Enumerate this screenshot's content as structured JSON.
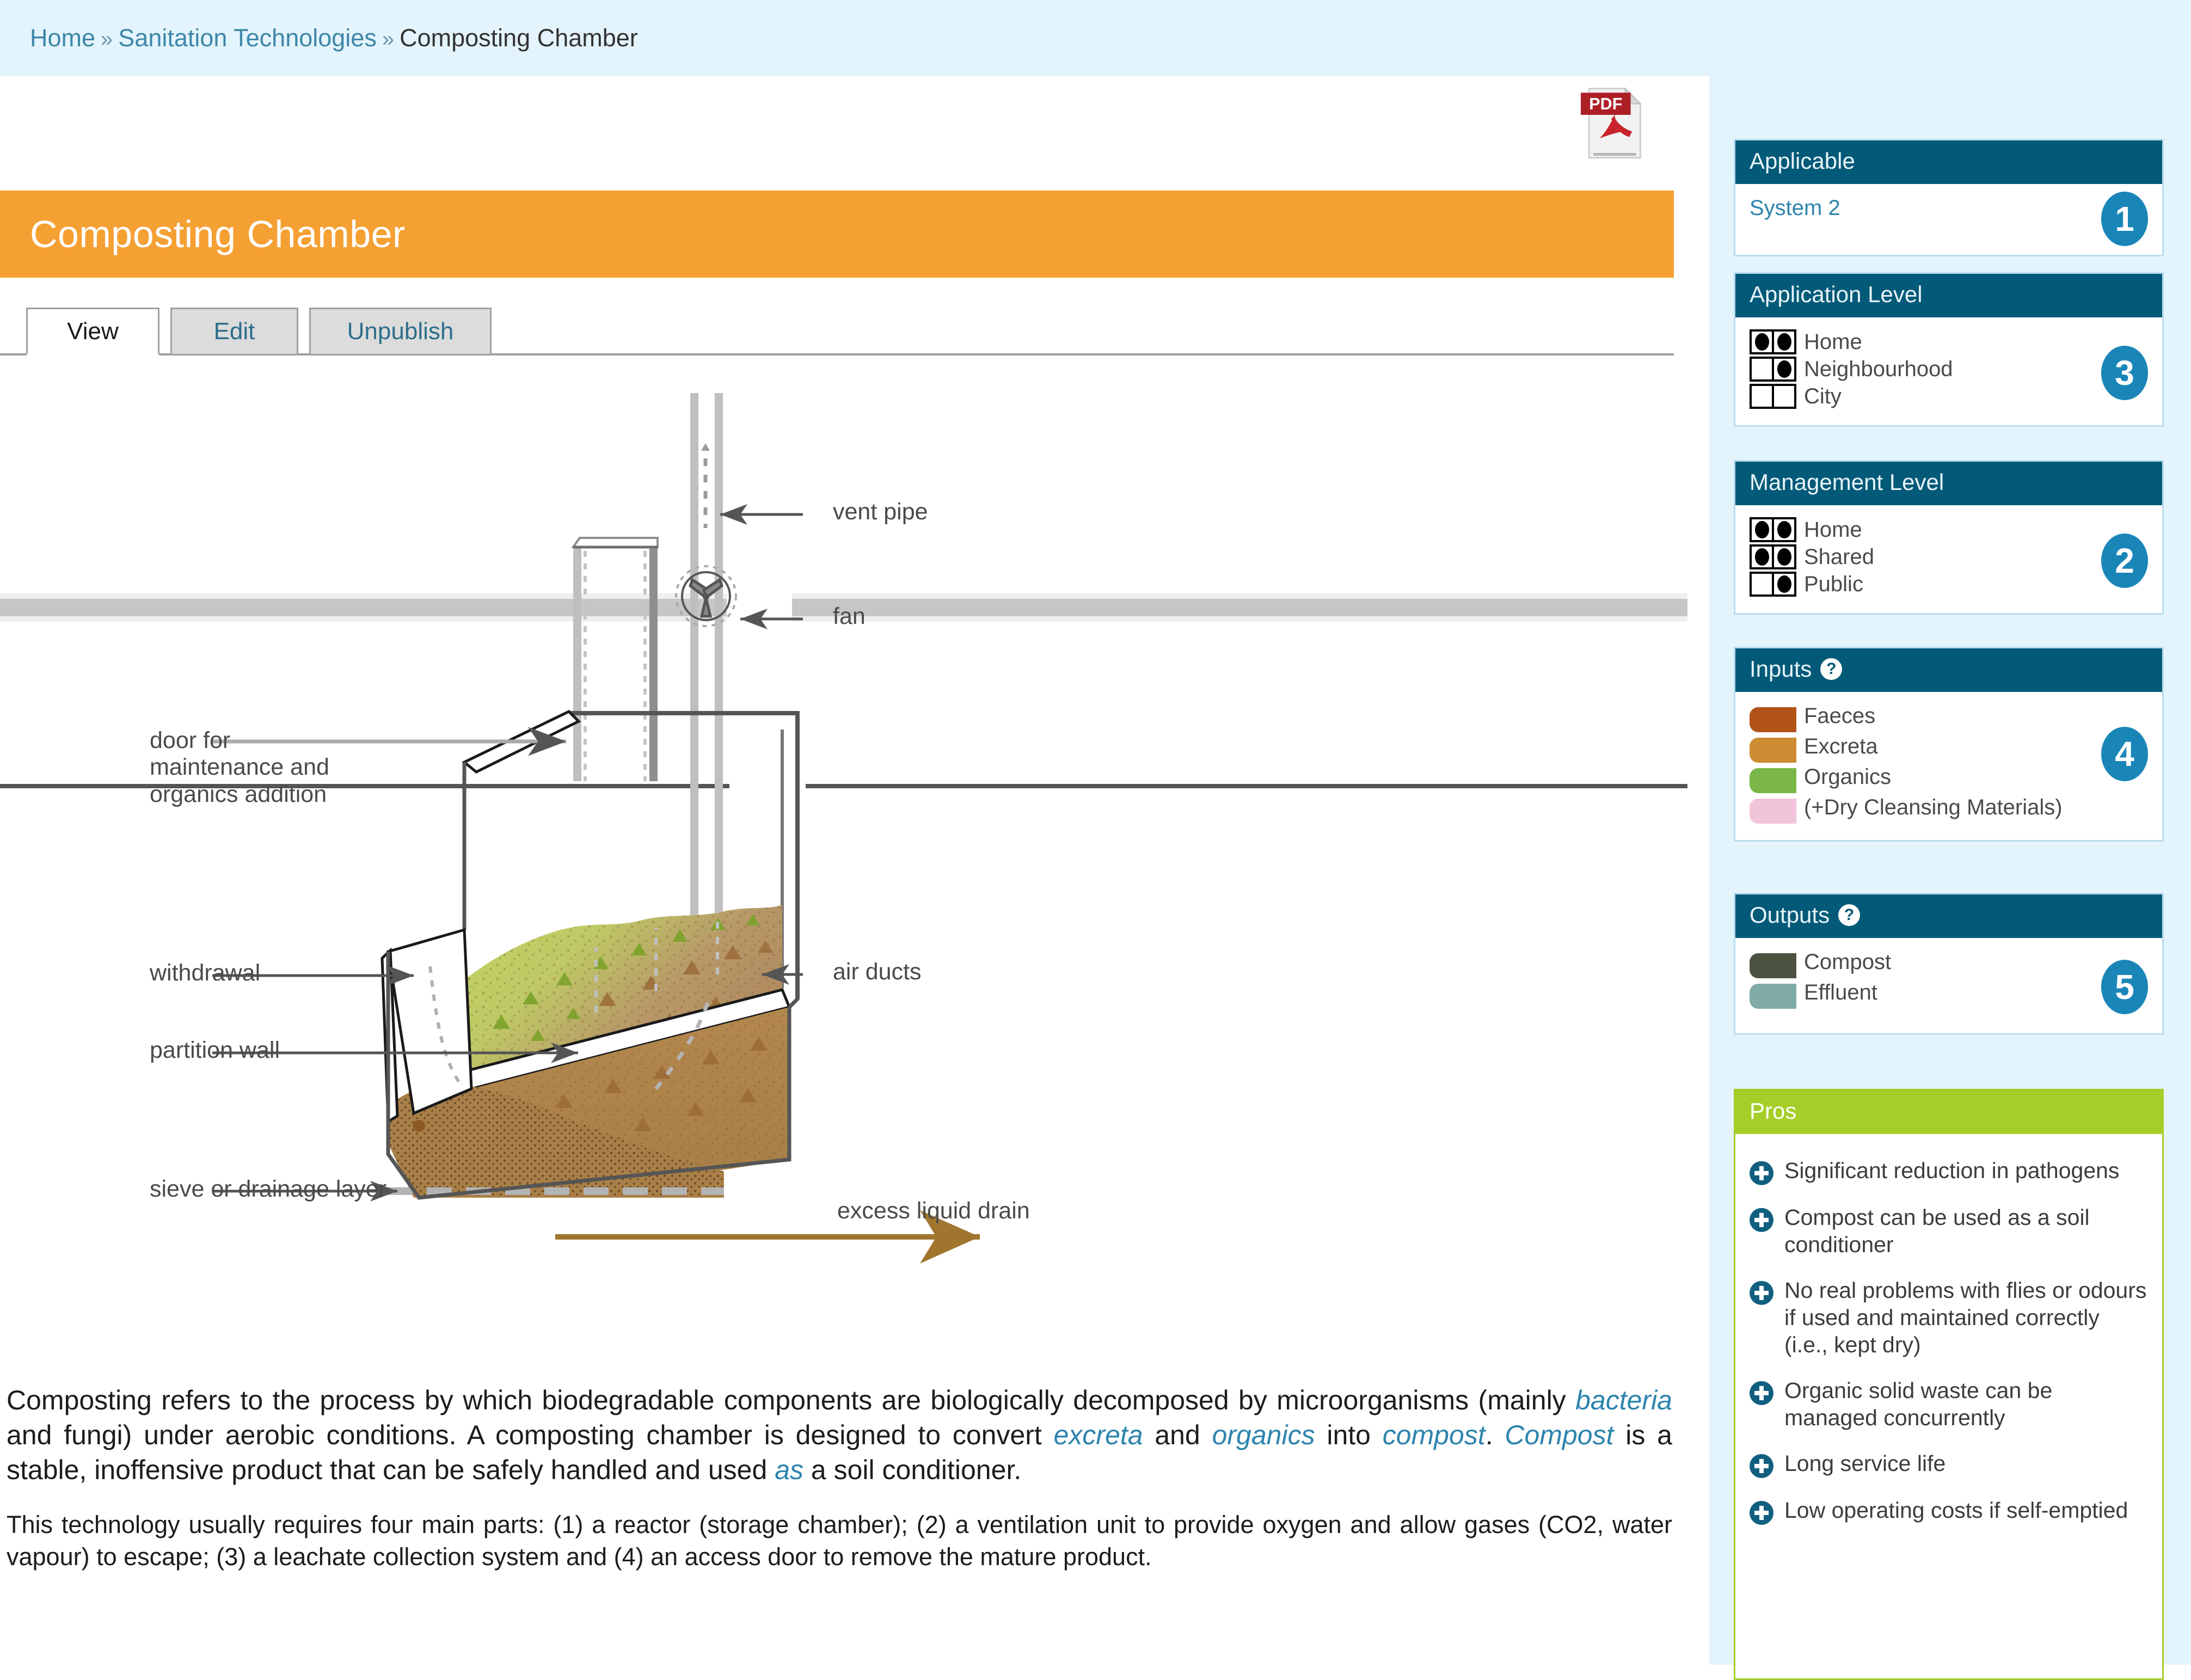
{
  "breadcrumb": {
    "home": "Home",
    "section": "Sanitation Technologies",
    "current": "Composting Chamber",
    "separator": "»"
  },
  "search": {
    "value": "",
    "placeholder": ""
  },
  "header": {
    "title": "Composting Chamber"
  },
  "tabs": [
    {
      "label": "View",
      "active": true
    },
    {
      "label": "Edit",
      "active": false
    },
    {
      "label": "Unpublish",
      "active": false
    }
  ],
  "pdf": {
    "label": "PDF"
  },
  "diagram": {
    "labels": {
      "vent_pipe": "vent pipe",
      "fan": "fan",
      "air_ducts": "air ducts",
      "door": "door for\nmaintenance and\norganics addition",
      "withdrawal": "withdrawal",
      "partition_wall": "partition wall",
      "sieve": "sieve or drainage layer",
      "excess_liquid_drain": "excess liquid drain"
    }
  },
  "body": {
    "p1_a": "Composting refers to the process by which biodegradable components are biologically decomposed by microorganisms (mainly ",
    "p1_bacteria": "bacteria",
    "p1_b": " and fungi) under aerobic conditions. A composting chamber is designed to convert ",
    "p1_excreta": "excreta",
    "p1_c": " and ",
    "p1_organics": "organics",
    "p1_d": " into ",
    "p1_compost": "compost",
    "p1_e": ". ",
    "p1_compost2": "Compost",
    "p1_f": " is a stable, inoffensive product that can be safely handled and used ",
    "p1_as": "as",
    "p1_g": " a soil conditioner.",
    "p2": "This technology usually requires four main parts: (1) a reactor (storage chamber); (2) a ventilation unit to provide oxygen and allow gases (CO2, water vapour) to escape; (3) a leachate collection system and (4) an access door to remove the mature product."
  },
  "sidebar": {
    "applicable": {
      "title": "Applicable",
      "system": "System 2",
      "badge": "1"
    },
    "application_level": {
      "title": "Application Level",
      "badge": "3",
      "rows": [
        {
          "label": "Home",
          "left": true,
          "right": true
        },
        {
          "label": "Neighbourhood",
          "left": false,
          "right": true
        },
        {
          "label": "City",
          "left": false,
          "right": false
        }
      ]
    },
    "management_level": {
      "title": "Management Level",
      "badge": "2",
      "rows": [
        {
          "label": "Home",
          "left": true,
          "right": true
        },
        {
          "label": "Shared",
          "left": true,
          "right": true
        },
        {
          "label": "Public",
          "left": false,
          "right": true
        }
      ]
    },
    "inputs": {
      "title": "Inputs",
      "help": "?",
      "badge": "4",
      "items": [
        {
          "label": "Faeces",
          "color": "#b2541a"
        },
        {
          "label": "Excreta",
          "color": "#cd8b33"
        },
        {
          "label": "Organics",
          "color": "#7ab648"
        },
        {
          "label": "(+Dry Cleansing Materials)",
          "color": "#f2c4da"
        }
      ]
    },
    "outputs": {
      "title": "Outputs",
      "help": "?",
      "badge": "5",
      "items": [
        {
          "label": "Compost",
          "color": "#4b5340"
        },
        {
          "label": "Effluent",
          "color": "#80aaa8"
        }
      ]
    },
    "pros": {
      "title": "Pros",
      "items": [
        "Significant reduction in pathogens",
        "Compost can be used as a soil conditioner",
        "No real problems with flies or odours if used and maintained correctly (i.e., kept dry)",
        "Organic solid waste can be managed concurrently",
        "Long service life",
        "Low operating costs if self-emptied"
      ]
    }
  },
  "colors": {
    "title_bar": "#f5a033",
    "panel_header": "#025a78",
    "pros_header": "#a5ce28",
    "badge": "#1a86b8",
    "link": "#2d84ad",
    "topbar": "#e4f4fc"
  }
}
